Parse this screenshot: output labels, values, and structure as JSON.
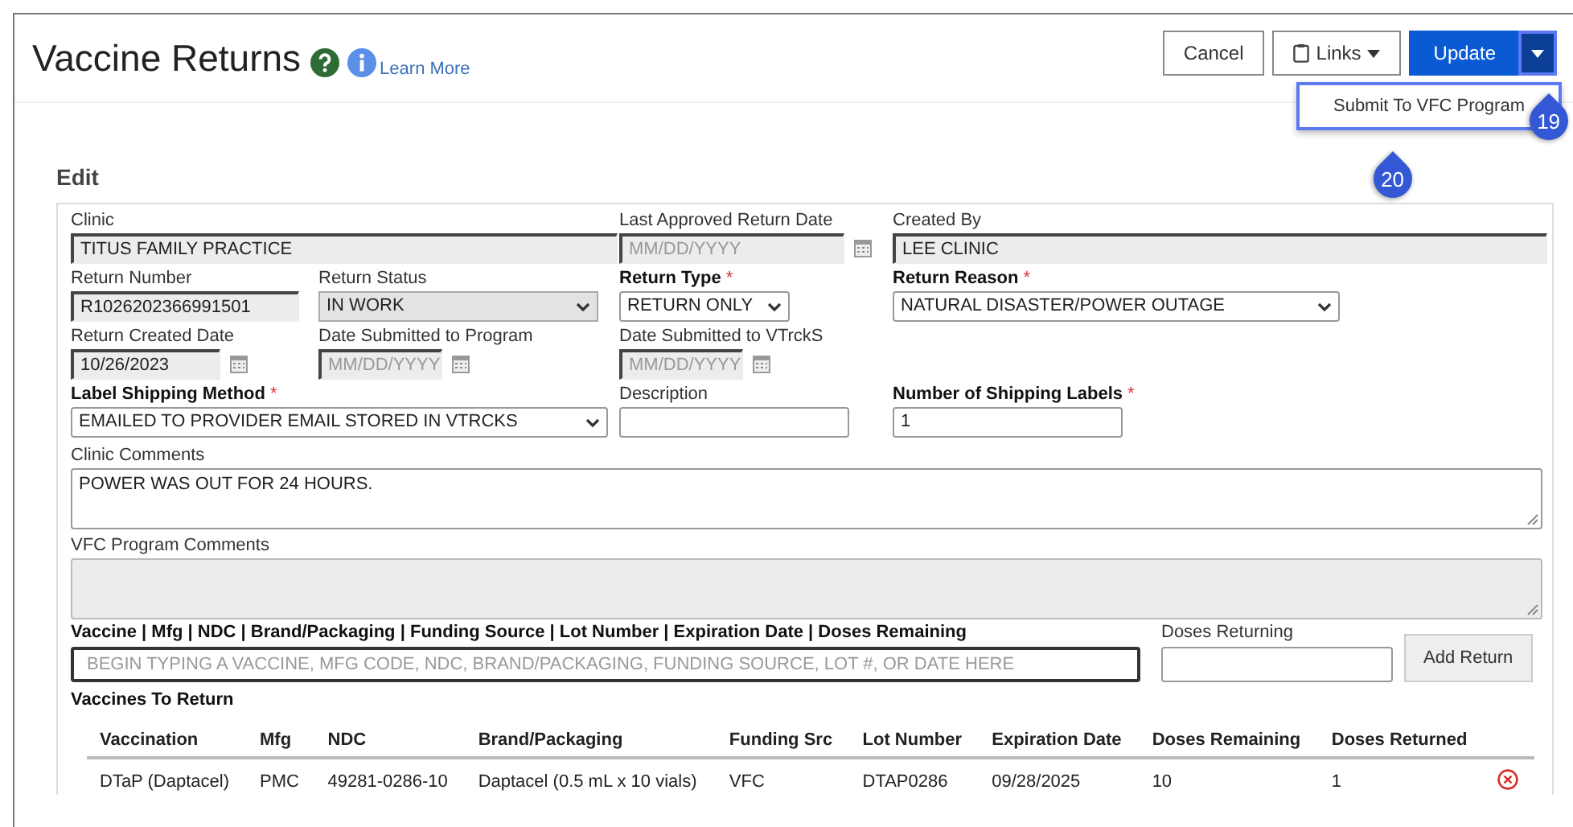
{
  "header": {
    "title": "Vaccine Returns",
    "learn_more": "Learn More",
    "buttons": [
      {
        "kind": "plain",
        "label": "Cancel"
      },
      {
        "kind": "links",
        "label": "Links"
      },
      {
        "kind": "primary",
        "label": "Update"
      }
    ],
    "menu": {
      "expanded": true,
      "items": [
        "Submit To VFC Program"
      ]
    },
    "callouts": [
      {
        "kind": "caret",
        "label": "19"
      },
      {
        "kind": "menu",
        "label": "20"
      }
    ]
  },
  "section_title": "Edit",
  "form": {
    "required_mark": "*",
    "fields": [
      {
        "kind": "text",
        "label": "Clinic",
        "value": "TITUS FAMILY PRACTICE",
        "disabled": true,
        "required": false
      },
      {
        "kind": "date",
        "label": "Last Approved Return Date",
        "placeholder": "MM/DD/YYYY",
        "disabled": true,
        "required": false
      },
      {
        "kind": "text",
        "label": "Created By",
        "value": "LEE CLINIC",
        "disabled": true,
        "required": false
      },
      {
        "kind": "text",
        "label": "Return Number",
        "value": "R1026202366991501",
        "disabled": true,
        "required": false
      },
      {
        "kind": "select",
        "label": "Return Status",
        "value": "IN WORK",
        "disabled": true,
        "required": false
      },
      {
        "kind": "select",
        "label": "Return Type",
        "value": "RETURN ONLY",
        "disabled": false,
        "required": true
      },
      {
        "kind": "select",
        "label": "Return Reason",
        "value": "NATURAL DISASTER/POWER OUTAGE",
        "disabled": false,
        "required": true
      },
      {
        "kind": "date",
        "label": "Return Created Date",
        "value": "10/26/2023",
        "disabled": true,
        "required": false
      },
      {
        "kind": "date",
        "label": "Date Submitted to Program",
        "placeholder": "MM/DD/YYYY",
        "disabled": true,
        "required": false
      },
      {
        "kind": "date",
        "label": "Date Submitted to VTrckS",
        "placeholder": "MM/DD/YYYY",
        "disabled": true,
        "required": false
      },
      {
        "kind": "select",
        "label": "Label Shipping Method",
        "value": "EMAILED TO PROVIDER EMAIL STORED IN VTRCKS",
        "disabled": false,
        "required": true
      },
      {
        "kind": "text",
        "label": "Description",
        "disabled": false,
        "required": false
      },
      {
        "kind": "text",
        "label": "Number of Shipping Labels",
        "value": "1",
        "disabled": false,
        "required": true
      }
    ],
    "comments": [
      {
        "label": "Clinic Comments",
        "value": "POWER WAS OUT FOR 24 HOURS.",
        "disabled": false
      },
      {
        "label": "VFC Program Comments",
        "disabled": true
      }
    ]
  },
  "vaccine_search": {
    "label": "Vaccine | Mfg | NDC | Brand/Packaging | Funding Source | Lot Number | Expiration Date | Doses Remaining",
    "placeholder": "BEGIN TYPING A VACCINE, MFG CODE, NDC, BRAND/PACKAGING, FUNDING SOURCE, LOT #, OR DATE HERE",
    "doses_label": "Doses Returning",
    "add_button": "Add Return"
  },
  "table": {
    "title": "Vaccines To Return",
    "columns": [
      "Vaccination",
      "Mfg",
      "NDC",
      "Brand/Packaging",
      "Funding Src",
      "Lot Number",
      "Expiration Date",
      "Doses Remaining",
      "Doses Returned"
    ],
    "rows": [
      [
        "DTaP (Daptacel)",
        "PMC",
        "49281-0286-10",
        "Daptacel (0.5 mL x 10 vials)",
        "VFC",
        "DTAP0286",
        "09/28/2025",
        "10",
        "1"
      ]
    ]
  }
}
